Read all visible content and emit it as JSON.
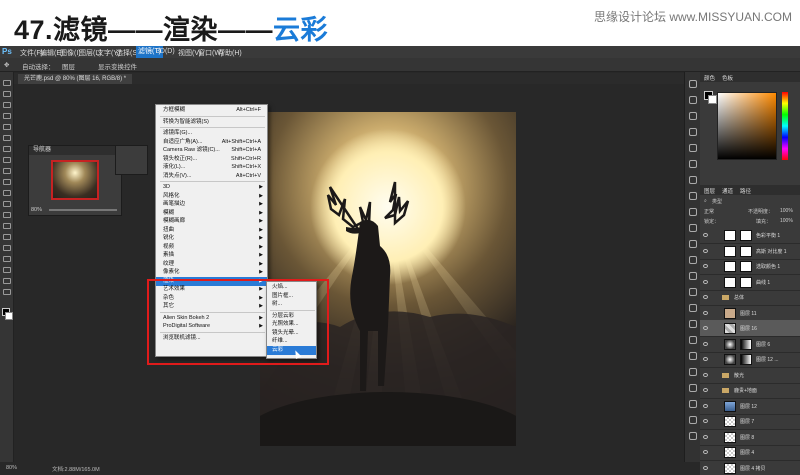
{
  "header": {
    "title": "47.滤镜——渲染——云彩",
    "watermark": "思缘设计论坛 www.MISSYUAN.COM"
  },
  "ps": {
    "logo": "Ps",
    "menus": [
      "文件(F)",
      "编辑(E)",
      "图像(I)",
      "图层(L)",
      "文字(Y)",
      "选择(S)",
      "滤镜(T)",
      "3D(D)",
      "视图(V)",
      "窗口(W)",
      "帮助(H)"
    ],
    "options": [
      "自动选择：",
      "图层",
      "显示变换控件"
    ],
    "doc_tab": "光芒鹿.psd @ 80% (图层 16, RGB/8) *",
    "status": "80%",
    "status_doc": "文档:2.88M/165.0M",
    "navigator_title": "导航器",
    "navigator_zoom": "80%"
  },
  "filter_menu": {
    "items": [
      {
        "label": "方框模糊",
        "shortcut": "Alt+Ctrl+F"
      },
      {
        "sep": true
      },
      {
        "label": "转换为智能滤镜(S)"
      },
      {
        "sep": true
      },
      {
        "label": "滤镜库(G)..."
      },
      {
        "label": "自适应广角(A)...",
        "shortcut": "Alt+Shift+Ctrl+A"
      },
      {
        "label": "Camera Raw 滤镜(C)...",
        "shortcut": "Shift+Ctrl+A"
      },
      {
        "label": "镜头校正(R)...",
        "shortcut": "Shift+Ctrl+R"
      },
      {
        "label": "液化(L)...",
        "shortcut": "Shift+Ctrl+X"
      },
      {
        "label": "消失点(V)...",
        "shortcut": "Alt+Ctrl+V"
      },
      {
        "sep": true
      },
      {
        "label": "3D",
        "sub": true
      },
      {
        "label": "风格化",
        "sub": true
      },
      {
        "label": "画笔描边",
        "sub": true
      },
      {
        "label": "模糊",
        "sub": true
      },
      {
        "label": "模糊画廊",
        "sub": true
      },
      {
        "label": "扭曲",
        "sub": true
      },
      {
        "label": "锐化",
        "sub": true
      },
      {
        "label": "视频",
        "sub": true
      },
      {
        "label": "素描",
        "sub": true
      },
      {
        "label": "纹理",
        "sub": true
      },
      {
        "label": "像素化",
        "sub": true
      },
      {
        "label": "渲染",
        "sub": true,
        "highlight": true
      },
      {
        "label": "艺术效果",
        "sub": true
      },
      {
        "label": "杂色",
        "sub": true
      },
      {
        "label": "其它",
        "sub": true
      },
      {
        "sep": true
      },
      {
        "label": "Alien Skin Bokeh 2",
        "sub": true
      },
      {
        "label": "ProDigital Software",
        "sub": true
      },
      {
        "sep": true
      },
      {
        "label": "浏览联机滤镜..."
      }
    ]
  },
  "render_submenu": {
    "items": [
      {
        "label": "火焰..."
      },
      {
        "label": "图片框..."
      },
      {
        "label": "树..."
      },
      {
        "sep": true
      },
      {
        "label": "分层云彩"
      },
      {
        "label": "光照效果..."
      },
      {
        "label": "镜头光晕..."
      },
      {
        "label": "纤维..."
      },
      {
        "label": "云彩",
        "highlight": true
      }
    ]
  },
  "color_panel": {
    "tabs": [
      "颜色",
      "色板"
    ],
    "accent": "#ff8a00"
  },
  "layers_panel": {
    "tabs": [
      "图层",
      "通道",
      "路径"
    ],
    "filter_label": "类型",
    "mode": "正常",
    "opacity_label": "不透明度：",
    "opacity": "100%",
    "lock_label": "锁定：",
    "fill_label": "填充：",
    "fill": "100%",
    "layers": [
      {
        "name": "色彩平衡 1",
        "type": "adj"
      },
      {
        "name": "高斯 对比度 1",
        "type": "adj"
      },
      {
        "name": "选取颜色 1",
        "type": "adj"
      },
      {
        "name": "曲线 1",
        "type": "adj"
      },
      {
        "name": "总体",
        "type": "group"
      },
      {
        "name": "图层 11",
        "type": "tan"
      },
      {
        "name": "图层 16",
        "type": "cloud",
        "selected": true
      },
      {
        "name": "图层 6",
        "type": "mask"
      },
      {
        "name": "图层 12 ...",
        "type": "mask"
      },
      {
        "name": "散光",
        "type": "group"
      },
      {
        "name": "鹿贵+地面",
        "type": "group"
      },
      {
        "name": "图层 12",
        "type": "blue"
      },
      {
        "name": "图层 7",
        "type": "checker"
      },
      {
        "name": "图层 8",
        "type": "checker"
      },
      {
        "name": "图层 4",
        "type": "checker"
      },
      {
        "name": "图层 4 拷贝",
        "type": "checker"
      }
    ]
  }
}
